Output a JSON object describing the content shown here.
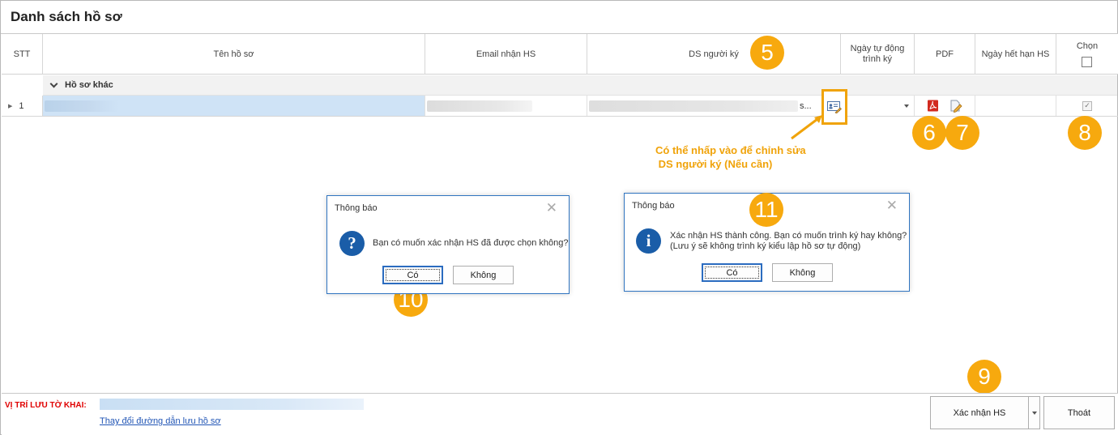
{
  "window": {
    "title": "Danh sách hồ sơ"
  },
  "grid": {
    "columns": {
      "stt": "STT",
      "ten_ho_so": "Tên hồ sơ",
      "email_nhan_hs": "Email nhận HS",
      "ds_nguoi_ky": "DS người ký",
      "ngay_tu_dong_trinh_ky": "Ngày tự động trình ký",
      "pdf": "PDF",
      "ngay_het_han_hs": "Ngày hết hạn HS",
      "chon": "Chọn"
    },
    "group": {
      "label": "Hồ sơ khác"
    },
    "rows": [
      {
        "stt": "1",
        "ds_nguoi_ky_suffix": "s...",
        "chon_checked": true
      }
    ]
  },
  "annotations": {
    "note": "Có thể nhấp vào để chỉnh sửa\n DS người ký (Nếu cần)",
    "badges": [
      "5",
      "6",
      "7",
      "8",
      "9",
      "10",
      "11"
    ]
  },
  "dialog_confirm": {
    "title": "Thông báo",
    "icon": "question-icon",
    "message": "Bạn có muốn xác nhận HS đã được chọn không?",
    "yes_label": "Có",
    "no_label": "Không"
  },
  "dialog_success": {
    "title": "Thông báo",
    "icon": "info-icon",
    "message_line1": "Xác nhận HS thành công. Bạn có muốn trình ký hay không?",
    "message_line2": "(Lưu ý sẽ không trình ký kiểu lập hồ sơ tự động)",
    "yes_label": "Có",
    "no_label": "Không"
  },
  "footer": {
    "location_label": "VỊ TRÍ LƯU TỜ KHAI:",
    "change_path_link": "Thay đổi đường dẫn lưu hồ sơ",
    "confirm_button": "Xác nhận HS",
    "exit_button": "Thoát"
  },
  "colors": {
    "badge": "#f7a90e",
    "highlight": "#f0a30a",
    "footer_label": "#e00000",
    "link": "#2155b5",
    "dialog_border": "#2f74c0",
    "selection": "#cfe3f6"
  }
}
